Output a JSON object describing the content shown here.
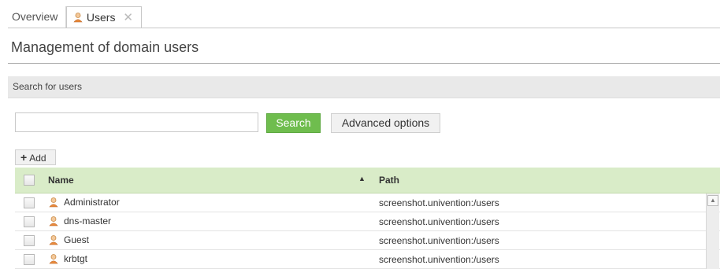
{
  "tabs": [
    {
      "label": "Overview"
    },
    {
      "label": "Users",
      "icon": "user-icon",
      "close": "✕"
    }
  ],
  "page": {
    "title": "Management of domain users"
  },
  "search": {
    "section_label": "Search for users",
    "placeholder": "",
    "value": "",
    "search_label": "Search",
    "advanced_label": "Advanced options",
    "accent": "#6fbd4e"
  },
  "toolbar": {
    "add_label": "Add"
  },
  "table": {
    "columns": [
      "Name",
      "Path"
    ],
    "sort": "ascending",
    "header_color": "#d9ecc8",
    "rows": [
      {
        "name": "Administrator",
        "path": "screenshot.univention:/users"
      },
      {
        "name": "dns-master",
        "path": "screenshot.univention:/users"
      },
      {
        "name": "Guest",
        "path": "screenshot.univention:/users"
      },
      {
        "name": "krbtgt",
        "path": "screenshot.univention:/users"
      }
    ]
  }
}
